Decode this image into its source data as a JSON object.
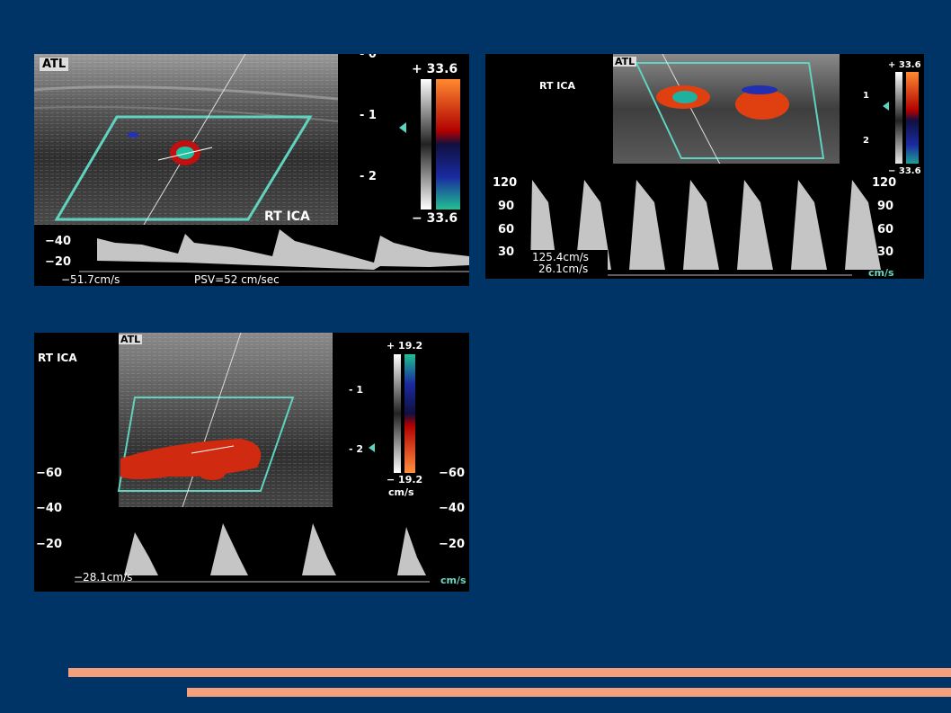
{
  "colors": {
    "background": "#003366",
    "stripe": "#F4A07C",
    "box": "#5FD3BF",
    "cyan_text": "#69D7C5"
  },
  "panel1": {
    "logo": "ATL",
    "label": "RT ICA",
    "scale_top": "+ 33.6",
    "scale_bottom": "− 33.6",
    "depth_labels": [
      "- 0",
      "- 1",
      "- 2"
    ],
    "spectral_labels": [
      "−40",
      "−20"
    ],
    "velocity": "−51.7cm/s",
    "psv": "PSV=52 cm/sec"
  },
  "panel2": {
    "logo": "ATL",
    "label": "RT ICA",
    "scale_top": "+ 33.6",
    "scale_bottom": "− 33.6",
    "depth_labels": [
      "1",
      "2"
    ],
    "spectral_labels_left": [
      "120",
      "90",
      "60",
      "30"
    ],
    "spectral_labels_right": [
      "120",
      "90",
      "60",
      "30"
    ],
    "velocity_1": "125.4cm/s",
    "velocity_2": "26.1cm/s",
    "units": "cm/s"
  },
  "panel3": {
    "logo": "ATL",
    "label": "RT ICA",
    "scale_top": "+ 19.2",
    "scale_bottom": "− 19.2",
    "scale_units": "cm/s",
    "depth_labels": [
      "- 1",
      "- 2"
    ],
    "spectral_labels_left": [
      "−60",
      "−40",
      "−20"
    ],
    "spectral_labels_right": [
      "−60",
      "−40",
      "−20"
    ],
    "velocity": "−28.1cm/s",
    "units": "cm/s"
  }
}
